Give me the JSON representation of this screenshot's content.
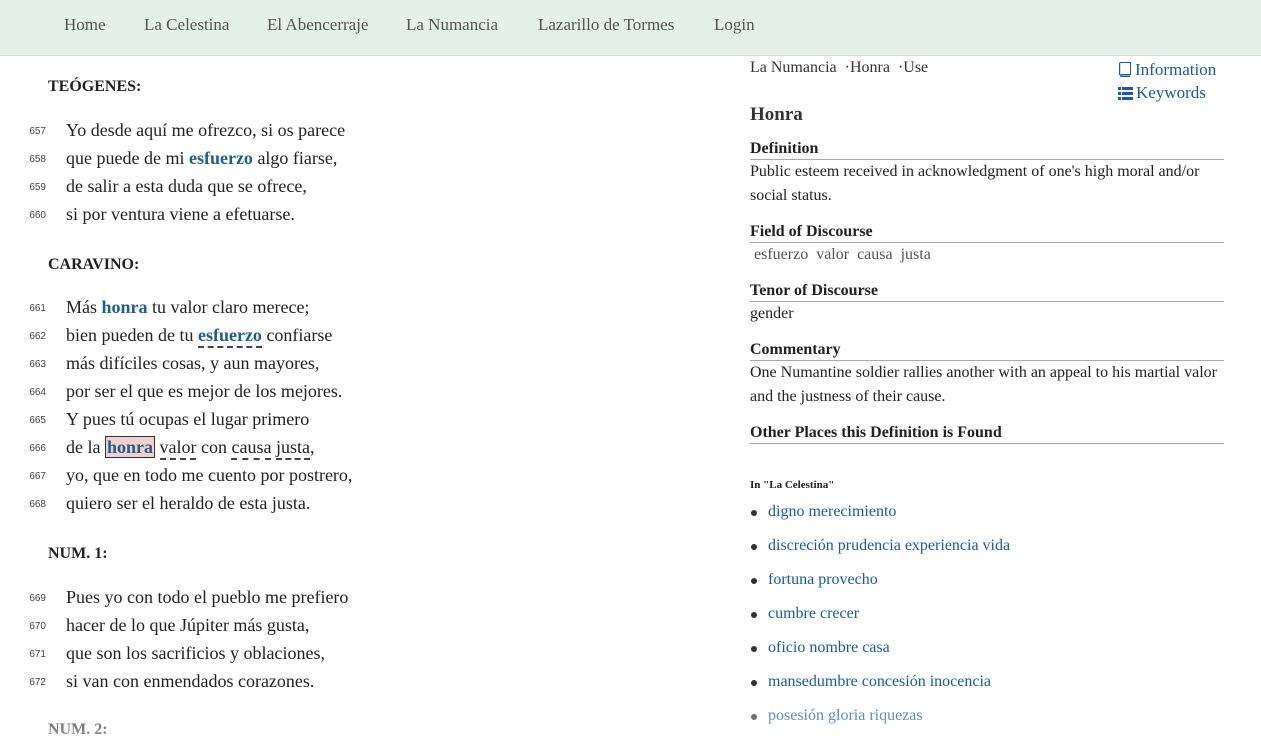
{
  "nav": [
    "Home",
    "La Celestina",
    "El Abencerraje",
    "La Numancia",
    "Lazarillo de Tormes",
    "Login"
  ],
  "speakers": [
    "TEÓGENES:",
    "CARAVINO:",
    "NUM. 1:",
    "NUM. 2:"
  ],
  "lines": [
    {
      "n": "657",
      "text": "Yo desde aquí me ofrezco, si os parece"
    },
    {
      "n": "658",
      "pre": "que puede de mi ",
      "kw": "esfuerzo",
      "post": " algo fiarse,"
    },
    {
      "n": "659",
      "text": "de salir a esta duda que se ofrece,"
    },
    {
      "n": "660",
      "text": "si por ventura viene a efetuarse."
    },
    {
      "n": "661",
      "pre": "Más ",
      "kw": "honra",
      "post": " tu valor claro merece;"
    },
    {
      "n": "662",
      "pre": "bien pueden de tu ",
      "kw": "esfuerzo",
      "post": " confiarse"
    },
    {
      "n": "663",
      "text": "más difíciles cosas, y aun mayores,"
    },
    {
      "n": "664",
      "text": "por ser el que es mejor de los mejores."
    },
    {
      "n": "665",
      "text": "Y pues tú ocupas el lugar primero"
    },
    {
      "n": "666",
      "pre": "de la ",
      "kw": "honra",
      "w1": "valor",
      "mid": " con ",
      "w2": "causa",
      "w3": "justa",
      "post": ","
    },
    {
      "n": "667",
      "text": "yo, que en todo me cuento por postrero,"
    },
    {
      "n": "668",
      "text": "quiero ser el heraldo de esta justa."
    },
    {
      "n": "669",
      "text": "Pues yo con todo el pueblo me prefiero"
    },
    {
      "n": "670",
      "text": "hacer de lo que Júpiter más gusta,"
    },
    {
      "n": "671",
      "text": "que son los sacrificios y oblaciones,"
    },
    {
      "n": "672",
      "text": "si van con enmendados corazones."
    }
  ],
  "panel": {
    "breadcrumb": {
      "work": "La Numancia",
      "term": "Honra",
      "use": "Use"
    },
    "info_link": "Information",
    "keywords_link": "Keywords",
    "title": "Honra",
    "definition_h": "Definition",
    "definition": "Public esteem received in acknowledgment of one's high moral and/or social status.",
    "field_h": "Field of Discourse",
    "field_tags": [
      "esfuerzo",
      "valor",
      "causa",
      "justa"
    ],
    "tenor_h": "Tenor of Discourse",
    "tenor": "gender",
    "commentary_h": "Commentary",
    "commentary": "One Numantine soldier rallies another with an appeal to his martial valor and the justness of their cause.",
    "other_h": "Other Places this Definition is Found",
    "in_label": "In \"La Celestina\"",
    "places": [
      "digno  merecimiento",
      "discreción  prudencia  experiencia  vida",
      "fortuna  provecho",
      "cumbre  crecer",
      "oficio  nombre  casa",
      "mansedumbre  concesión  inocencia",
      "posesión  gloria  riquezas"
    ]
  },
  "colors": {
    "navbar": "#e3f1ea",
    "keyword": "#1d5f8a",
    "link": "#1a5aa6",
    "highlight": "#f3cfd0"
  }
}
